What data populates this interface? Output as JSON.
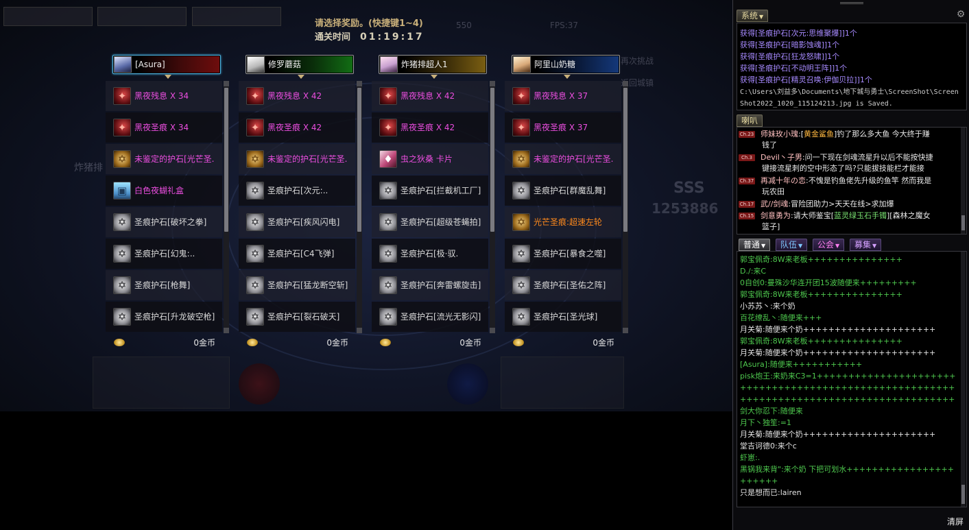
{
  "dialog": {
    "title": "请选择奖励。(快捷键1~4)",
    "time_label": "通关时间",
    "time_value": "01:19:17"
  },
  "players": [
    {
      "name": "[Asura]",
      "selected": true,
      "bar_color": "#6e0d0d",
      "gold": "0金币",
      "items": [
        {
          "name": "黑夜残息 X 34",
          "icon": "red-gem-icon",
          "color": "#ec4ee0"
        },
        {
          "name": "黑夜圣痕 X 34",
          "icon": "red-gem-icon",
          "color": "#ec4ee0"
        },
        {
          "name": "未鉴定的护石[光芒圣.",
          "icon": "gold-hexagram-icon",
          "color": "#ec4ee0"
        },
        {
          "name": "白色夜蝴礼盒",
          "icon": "gift-box-icon",
          "color": "#ec4ee0"
        },
        {
          "name": "圣痕护石[破坏之拳]",
          "icon": "silver-hexagram-icon",
          "color": "#d8d8d8"
        },
        {
          "name": "圣痕护石[幻鬼:..",
          "icon": "silver-hexagram-icon",
          "color": "#d8d8d8"
        },
        {
          "name": "圣痕护石[枪舞]",
          "icon": "silver-hexagram-icon",
          "color": "#d8d8d8"
        },
        {
          "name": "圣痕护石[升龙破空枪]",
          "icon": "silver-hexagram-icon",
          "color": "#d8d8d8"
        }
      ]
    },
    {
      "name": "修罗蘑菇",
      "selected": false,
      "bar_color": "#126d14",
      "gold": "0金币",
      "items": [
        {
          "name": "黑夜残息 X 42",
          "icon": "red-gem-icon",
          "color": "#ec4ee0"
        },
        {
          "name": "黑夜圣痕 X 42",
          "icon": "red-gem-icon",
          "color": "#ec4ee0"
        },
        {
          "name": "未鉴定的护石[光芒圣.",
          "icon": "gold-hexagram-icon",
          "color": "#ec4ee0"
        },
        {
          "name": "圣痕护石[次元:..",
          "icon": "silver-hexagram-icon",
          "color": "#d8d8d8"
        },
        {
          "name": "圣痕护石[疾风闪电]",
          "icon": "silver-hexagram-icon",
          "color": "#d8d8d8"
        },
        {
          "name": "圣痕护石[C4飞弹]",
          "icon": "silver-hexagram-icon",
          "color": "#d8d8d8"
        },
        {
          "name": "圣痕护石[猛龙断空斩]",
          "icon": "silver-hexagram-icon",
          "color": "#d8d8d8"
        },
        {
          "name": "圣痕护石[裂石破天]",
          "icon": "silver-hexagram-icon",
          "color": "#d8d8d8"
        }
      ]
    },
    {
      "name": "炸猪排超人1",
      "selected": false,
      "bar_color": "#7a5e12",
      "gold": "0金币",
      "items": [
        {
          "name": "黑夜残息 X 42",
          "icon": "red-gem-icon",
          "color": "#ec4ee0"
        },
        {
          "name": "黑夜圣痕 X 42",
          "icon": "red-gem-icon",
          "color": "#ec4ee0"
        },
        {
          "name": "虫之狄桑 卡片",
          "icon": "card-icon",
          "color": "#ec4ee0"
        },
        {
          "name": "圣痕护石[拦截机工厂]",
          "icon": "silver-hexagram-icon",
          "color": "#d8d8d8"
        },
        {
          "name": "圣痕护石[超级苍蝇拍]",
          "icon": "silver-hexagram-icon",
          "color": "#d8d8d8"
        },
        {
          "name": "圣痕护石[极·驭.",
          "icon": "silver-hexagram-icon",
          "color": "#d8d8d8"
        },
        {
          "name": "圣痕护石[奔雷螺旋击]",
          "icon": "silver-hexagram-icon",
          "color": "#d8d8d8"
        },
        {
          "name": "圣痕护石[流光无影闪]",
          "icon": "silver-hexagram-icon",
          "color": "#d8d8d8"
        }
      ]
    },
    {
      "name": "阿里山奶糖",
      "selected": false,
      "bar_color": "#14387a",
      "gold": "0金币",
      "items": [
        {
          "name": "黑夜残息 X 37",
          "icon": "red-gem-icon",
          "color": "#ec4ee0"
        },
        {
          "name": "黑夜圣痕 X 37",
          "icon": "red-gem-icon",
          "color": "#ec4ee0"
        },
        {
          "name": "未鉴定的护石[光芒圣.",
          "icon": "gold-hexagram-icon",
          "color": "#ec4ee0"
        },
        {
          "name": "圣痕护石[群魔乱舞]",
          "icon": "silver-hexagram-icon",
          "color": "#d8d8d8"
        },
        {
          "name": "光芒圣痕:超速左轮",
          "icon": "gold-hexagram-icon",
          "color": "#ff8a1c"
        },
        {
          "name": "圣痕护石[暴食之噬]",
          "icon": "silver-hexagram-icon",
          "color": "#d8d8d8"
        },
        {
          "name": "圣痕护石[圣佑之阵]",
          "icon": "silver-hexagram-icon",
          "color": "#d8d8d8"
        },
        {
          "name": "圣痕护石[圣光球]",
          "icon": "silver-hexagram-icon",
          "color": "#d8d8d8"
        }
      ]
    }
  ],
  "chat": {
    "system_tab": "系统",
    "horn_tab": "喇叭",
    "channel_tabs": [
      "普通",
      "队伍",
      "公会",
      "募集"
    ],
    "clear_button": "清屏",
    "system_lines": [
      "获得[圣痕护石[次元:思维聚爆]]1个",
      "获得[圣痕护石[暗影蚀魂]]1个",
      "获得[圣痕护石[狂龙怒啸]]1个",
      "获得[圣痕护石[不动明王阵]]1个",
      "获得[圣痕护石[精灵召唤:伊伽贝拉]]1个"
    ],
    "system_path": "C:\\Users\\刘益多\\Documents\\地下城与勇士\\ScreenShot\\ScreenShot2022_1020_115124213.jpg is Saved.",
    "horn_lines": [
      {
        "ch": "Ch.23",
        "sender": "师妹玫小瑰",
        "pre": ":[",
        "hl": "黄金鲨鱼",
        "post": "]钓了那么多大鱼 今大终于赚",
        "cont": "钱了",
        "hl_color": "#ffb840"
      },
      {
        "ch": "Ch.3",
        "sender": "Devil丶子男",
        "pre": ":问一下现在剑魂流星升以后不能按快捷",
        "hl": "",
        "post": "",
        "cont": "键接流星刺的空中形态了吗?只能拔技能栏才能接",
        "hl_color": "#ffb840"
      },
      {
        "ch": "Ch.37",
        "sender": "再减十年の恋",
        "pre": ":不愧是钓鱼佬先升级的鱼竿 然而我是",
        "hl": "",
        "post": "",
        "cont": "玩农田",
        "hl_color": "#ffb840"
      },
      {
        "ch": "Ch.17",
        "sender": "武//剑魂",
        "pre": ":冒险团助力>天天在线>求加爆",
        "hl": "",
        "post": "",
        "cont": "",
        "hl_color": "#ffb840"
      },
      {
        "ch": "Ch.15",
        "sender": "剑意勇为",
        "pre": ":请大师鉴宝[",
        "hl": "蓝灵绿玉石手镯",
        "post": "][森林之魔女",
        "cont": "篮子]",
        "hl_color": "#78e070"
      }
    ],
    "normal_lines": [
      {
        "speaker": "郭宝佩奇",
        "text": ":8W来老板+++++++++++++++",
        "color": "green"
      },
      {
        "speaker": "D./",
        "text": ":来C",
        "color": "green"
      },
      {
        "speaker": "0自创0",
        "text": ":曼殊沙华连开团15波随便来+++++++++",
        "color": "green"
      },
      {
        "speaker": "郭宝佩奇",
        "text": ":8W来老板+++++++++++++++",
        "color": "green"
      },
      {
        "speaker": "小苏苏丶",
        "text": ":来个奶",
        "color": "white"
      },
      {
        "speaker": "百花缭乱丶",
        "text": ":随便来+++",
        "color": "green"
      },
      {
        "speaker": "月关菊",
        "text": ":随便来个奶+++++++++++++++++++++",
        "color": "white"
      },
      {
        "speaker": "郭宝佩奇",
        "text": ":8W来老板+++++++++++++++",
        "color": "green"
      },
      {
        "speaker": "月关菊",
        "text": ":随便来个奶+++++++++++++++++++++",
        "color": "white"
      },
      {
        "speaker": "[Asura]",
        "text": ":随便来+++++++++++",
        "color": "green"
      },
      {
        "speaker": "pisk炮王",
        "text": ":来奶来C3=1++++++++++++++++++++++++++++++++++++++++++++++++++++++++++++++++++++++++++++++++++++++++++++++",
        "color": "green",
        "wrap": 3
      },
      {
        "speaker": "剑大你忍下",
        "text": ":随便来",
        "color": "green"
      },
      {
        "speaker": "月下丶独笙",
        "text": ":=1",
        "color": "green"
      },
      {
        "speaker": "月关菊",
        "text": ":随便来个奶+++++++++++++++++++++",
        "color": "white"
      },
      {
        "speaker": "堂吉诃德0",
        "text": ":来个c",
        "color": "white"
      },
      {
        "speaker": "虾崽",
        "text": ":.",
        "color": "green"
      },
      {
        "speaker": "黑锅我来背\"",
        "text": ":来个奶 下把可划水+++++++++++++++++++++++",
        "color": "green",
        "wrap": 2
      },
      {
        "speaker": "只是想而已",
        "text": ":lairen",
        "color": "white"
      }
    ]
  },
  "background_hud": {
    "fps": "FPS:37",
    "score": "SSS",
    "score_value": "1253886",
    "label_challenge": "再次挑战",
    "label_town": "返回城镇",
    "label_speed": "炸猪排",
    "dungeon_code": "550"
  }
}
